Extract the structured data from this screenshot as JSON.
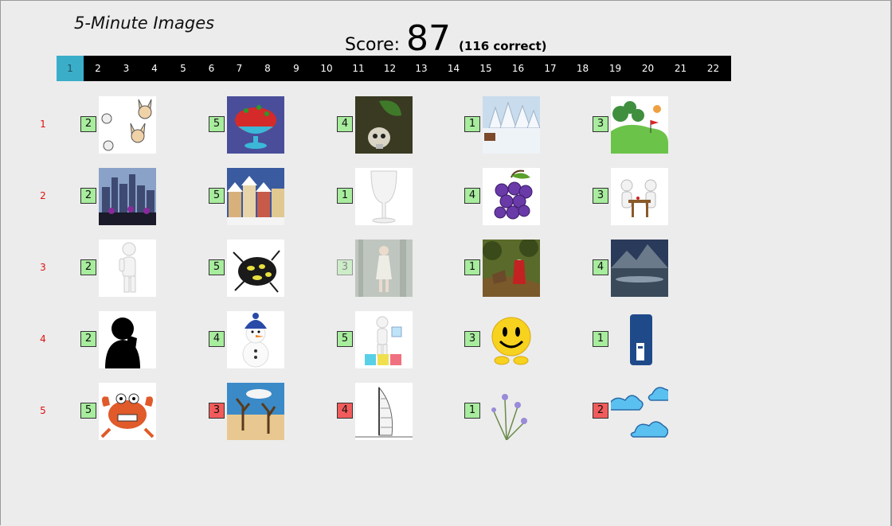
{
  "title": "5-Minute Images",
  "score": {
    "label": "Score:",
    "value": "87",
    "detail": "(116 correct)"
  },
  "pages": [
    "1",
    "2",
    "3",
    "4",
    "5",
    "6",
    "7",
    "8",
    "9",
    "10",
    "11",
    "12",
    "13",
    "14",
    "15",
    "16",
    "17",
    "18",
    "19",
    "20",
    "21",
    "22"
  ],
  "active_page": "1",
  "rows": [
    {
      "label": "1",
      "cells": [
        {
          "n": "2",
          "state": "correct",
          "image": "fennec-foxes-icon"
        },
        {
          "n": "5",
          "state": "correct",
          "image": "strawberry-bowl-icon"
        },
        {
          "n": "4",
          "state": "correct",
          "image": "skull-leaf-icon"
        },
        {
          "n": "1",
          "state": "correct",
          "image": "snowy-forest-icon"
        },
        {
          "n": "3",
          "state": "correct",
          "image": "golf-green-icon"
        }
      ]
    },
    {
      "label": "2",
      "cells": [
        {
          "n": "2",
          "state": "correct",
          "image": "city-skyline-icon"
        },
        {
          "n": "5",
          "state": "correct",
          "image": "winter-houses-icon"
        },
        {
          "n": "1",
          "state": "correct",
          "image": "wine-glass-icon"
        },
        {
          "n": "4",
          "state": "correct",
          "image": "grapes-icon"
        },
        {
          "n": "3",
          "state": "correct",
          "image": "figures-at-table-icon"
        }
      ]
    },
    {
      "label": "3",
      "cells": [
        {
          "n": "2",
          "state": "correct",
          "image": "thinking-figure-icon"
        },
        {
          "n": "5",
          "state": "correct",
          "image": "beetle-icon"
        },
        {
          "n": "3",
          "state": "faded",
          "image": "woman-in-forest-icon"
        },
        {
          "n": "1",
          "state": "correct",
          "image": "red-riding-hood-icon"
        },
        {
          "n": "4",
          "state": "correct",
          "image": "mountain-lake-icon"
        }
      ]
    },
    {
      "label": "4",
      "cells": [
        {
          "n": "2",
          "state": "correct",
          "image": "silhouette-icon"
        },
        {
          "n": "4",
          "state": "correct",
          "image": "snowman-icon"
        },
        {
          "n": "5",
          "state": "correct",
          "image": "figure-with-cubes-icon"
        },
        {
          "n": "3",
          "state": "correct",
          "image": "smiley-icon"
        },
        {
          "n": "1",
          "state": "correct",
          "image": "router-icon"
        }
      ]
    },
    {
      "label": "5",
      "cells": [
        {
          "n": "5",
          "state": "correct",
          "image": "crab-icon"
        },
        {
          "n": "3",
          "state": "wrong",
          "image": "desert-trees-icon"
        },
        {
          "n": "4",
          "state": "wrong",
          "image": "burj-al-arab-icon"
        },
        {
          "n": "1",
          "state": "correct",
          "image": "wildflowers-icon"
        },
        {
          "n": "2",
          "state": "wrong",
          "image": "clouds-icon"
        }
      ]
    }
  ],
  "colors": {
    "correct": "#a8ec9e",
    "wrong": "#f25b5b",
    "active_tab": "#3aaec9",
    "row_label": "#e01010"
  }
}
